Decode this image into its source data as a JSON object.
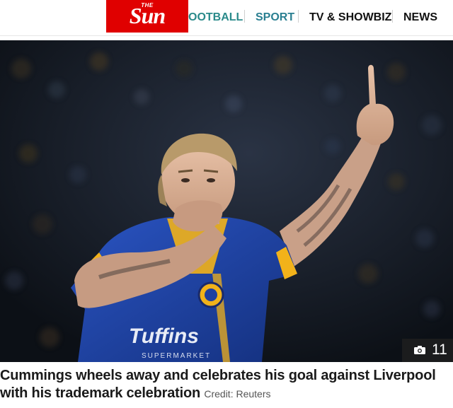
{
  "header": {
    "logo_small": "THE",
    "logo_main": "Sun",
    "nav": [
      "FOOTBALL",
      "SPORT",
      "TV & SHOWBIZ",
      "NEWS"
    ],
    "nav_football_visible": "OOTBALL"
  },
  "photo": {
    "gallery_count": "11",
    "shirt_sponsor": "Tuffins",
    "shirt_sponsor_sub": "SUPERMARKET"
  },
  "caption": {
    "text": "Cummings wheels away and celebrates his goal against Liverpool with his trademark celebration",
    "credit": "Credit: Reuters"
  },
  "colors": {
    "brand_red": "#e00000",
    "sport_teal": "#2a7f91",
    "shirt_blue": "#1f3fa0",
    "shirt_amber": "#f2b21a"
  }
}
